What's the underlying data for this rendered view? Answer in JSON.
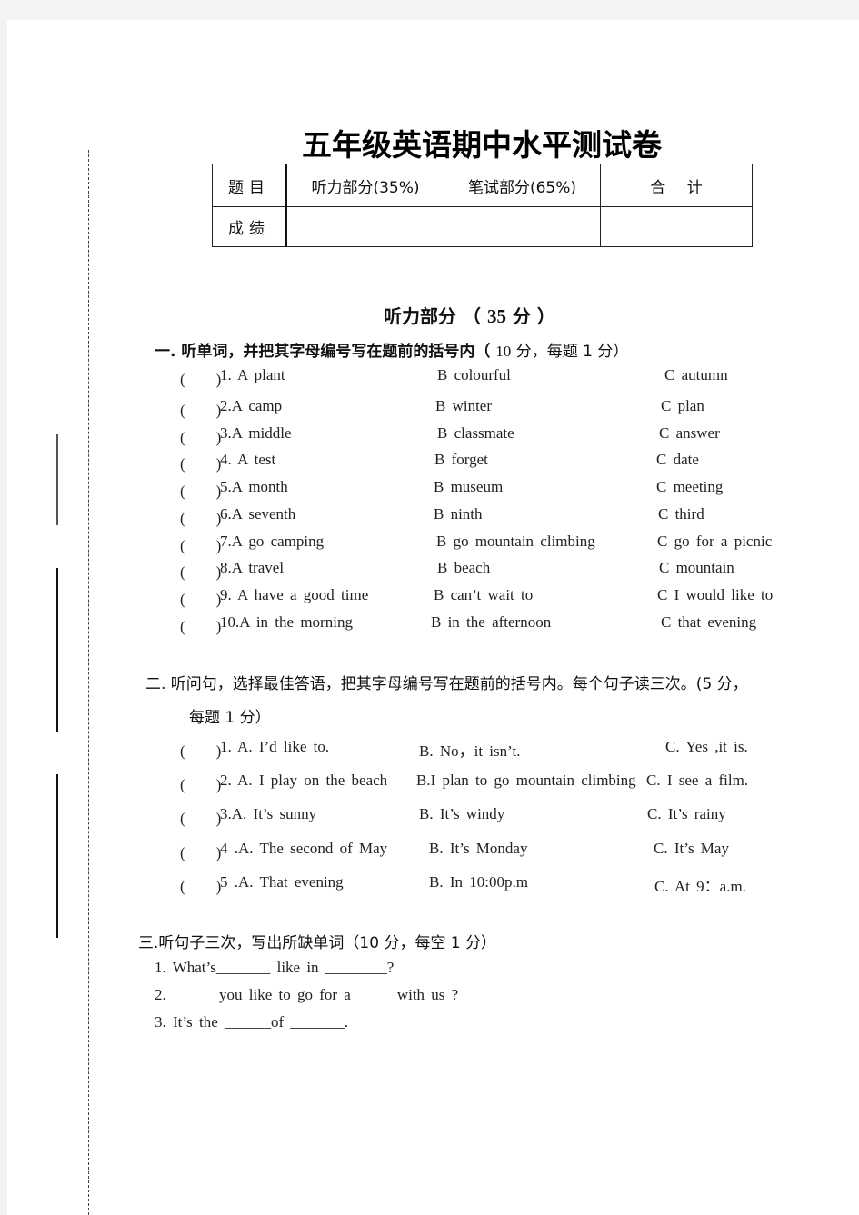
{
  "title": "五年级英语期中水平测试卷",
  "score_table": {
    "row1": [
      "题目",
      "听力部分(35%)",
      "笔试部分(65%)",
      "合 计"
    ],
    "row2": [
      "成绩",
      "",
      "",
      ""
    ]
  },
  "listening_section": {
    "title_prefix": "听力部分 （ ",
    "points": "35",
    "title_suffix": " 分 ）"
  },
  "part1": {
    "heading_main": "一. 听单词，并把其字母编号写在题前的括号内（ ",
    "heading_pts": "10",
    "heading_tail": " 分，每题 1 分）",
    "items": [
      {
        "paren": "(　　)",
        "a": "1. A  plant",
        "b": "B  colourful",
        "c": "C  autumn"
      },
      {
        "paren": "(　　)",
        "a": "2.A  camp",
        "b": "B  winter",
        "c": "C  plan"
      },
      {
        "paren": "(　　)",
        "a": "3.A  middle",
        "b": "B  classmate",
        "c": "C  answer"
      },
      {
        "paren": "(　　)",
        "a": "4. A  test",
        "b": "B  forget",
        "c": "C  date"
      },
      {
        "paren": "(　　)",
        "a": "5.A  month",
        "b": "B  museum",
        "c": "C  meeting"
      },
      {
        "paren": "(　　)",
        "a": "6.A  seventh",
        "b": "B  ninth",
        "c": "C  third"
      },
      {
        "paren": "(　　)",
        "a": "7.A  go camping",
        "b": "B  go mountain climbing",
        "c": "C  go for a picnic"
      },
      {
        "paren": "(　　)",
        "a": "8.A  travel",
        "b": "B  beach",
        "c": "C  mountain"
      },
      {
        "paren": "(　　)",
        "a": "9. A  have a good time",
        "b": "B  can’t wait to",
        "c": "C  I would like to"
      },
      {
        "paren": "(　　)",
        "a": "10.A  in the morning",
        "b": "B  in the afternoon",
        "c": "C  that evening"
      }
    ]
  },
  "part2": {
    "heading_line1": "二. 听问句，选择最佳答语，把其字母编号写在题前的括号内。每个句子读三次。(5 分，",
    "heading_line2": "每题 1 分）",
    "items": [
      {
        "paren": "(　　)",
        "a": "1. A. I’d like to.",
        "b": "B. No，it isn’t.",
        "c": "C. Yes ,it is."
      },
      {
        "paren": "(　　)",
        "a": "2. A. I play on the beach",
        "b": "B.I plan to go mountain climbing",
        "c": "C. I see a film."
      },
      {
        "paren": "(　　)",
        "a": "3.A. It’s sunny",
        "b": "B. It’s windy",
        "c": "C. It’s rainy"
      },
      {
        "paren": "(　　)",
        "a": "4 .A. The second of May",
        "b": "B. It’s Monday",
        "c": "C. It’s May"
      },
      {
        "paren": "(　　)",
        "a": "5 .A. That evening",
        "b": "B. In 10:00p.m",
        "c": "C. At 9：a.m."
      }
    ]
  },
  "part3": {
    "heading": "三.听句子三次，写出所缺单词（10 分，每空 1 分）",
    "items": [
      "1. What’s_______  like  in  ________?",
      "2. ______you  like  to  go  for  a______with  us   ?",
      "3. It’s  the  ______of  _______."
    ]
  }
}
